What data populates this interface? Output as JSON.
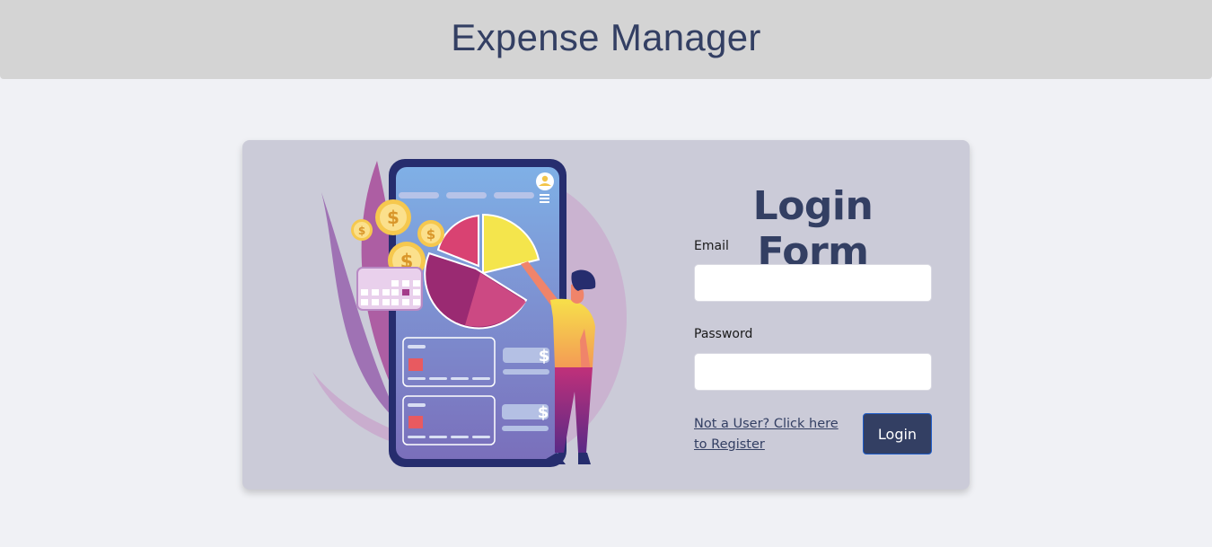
{
  "header": {
    "title": "Expense Manager"
  },
  "illustration": {
    "name": "finance-app-illustration",
    "currency_symbol": "$"
  },
  "login_form": {
    "title": "Login Form",
    "email": {
      "label": "Email",
      "value": "",
      "placeholder": ""
    },
    "password": {
      "label": "Password",
      "value": "",
      "placeholder": ""
    },
    "register_link": "Not a User? Click here to Register",
    "login_button": "Login"
  },
  "colors": {
    "header_bg": "#d4d4d4",
    "page_bg": "#f0f1f5",
    "card_bg": "#cbcbd8",
    "primary": "#333f63"
  }
}
